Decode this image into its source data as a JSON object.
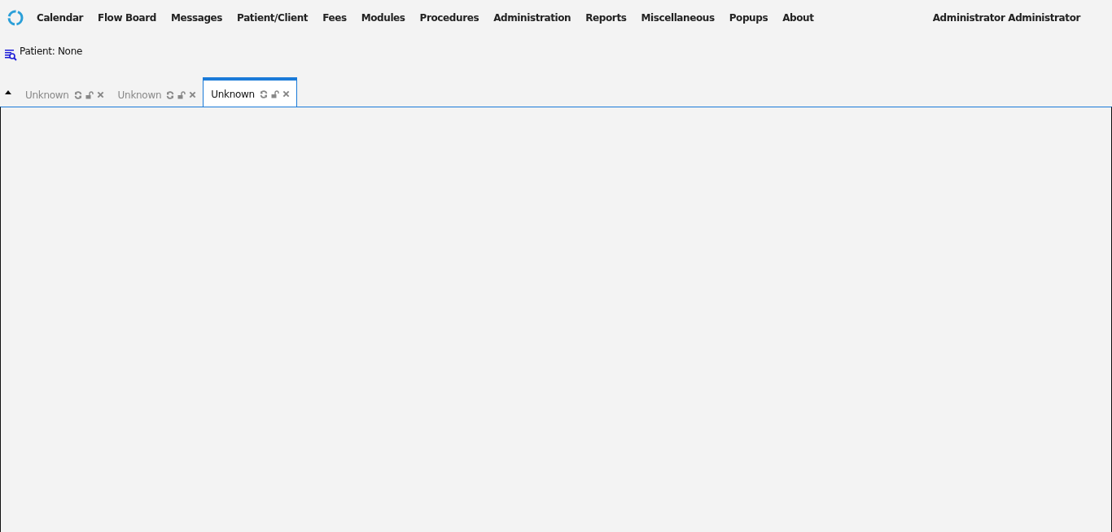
{
  "menu": [
    {
      "label": "Calendar"
    },
    {
      "label": "Flow Board"
    },
    {
      "label": "Messages"
    },
    {
      "label": "Patient/Client"
    },
    {
      "label": "Fees"
    },
    {
      "label": "Modules"
    },
    {
      "label": "Procedures"
    },
    {
      "label": "Administration"
    },
    {
      "label": "Reports"
    },
    {
      "label": "Miscellaneous"
    },
    {
      "label": "Popups"
    },
    {
      "label": "About"
    }
  ],
  "user": "Administrator Administrator",
  "patient": "Patient: None",
  "tabs": [
    {
      "label": "Unknown",
      "selected": false
    },
    {
      "label": "Unknown",
      "selected": false
    },
    {
      "label": "Unknown",
      "selected": true
    }
  ]
}
